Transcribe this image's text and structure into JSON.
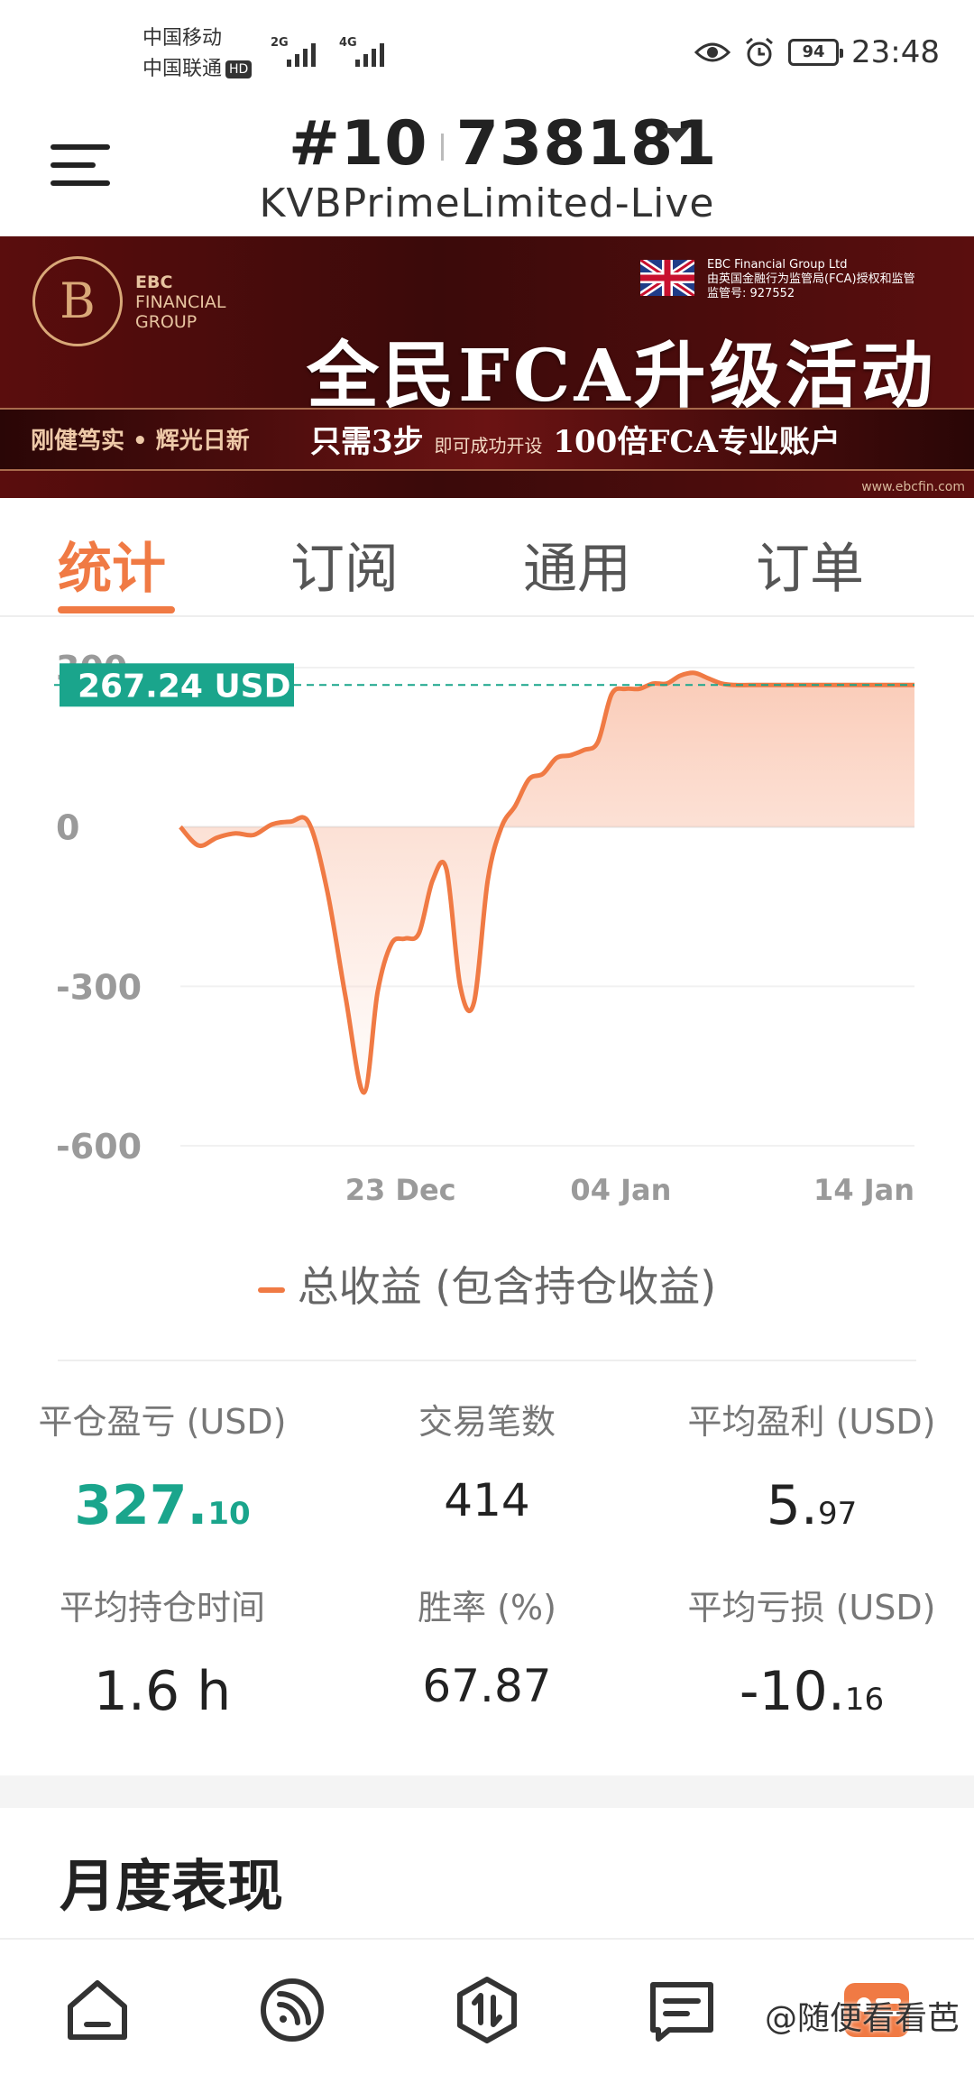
{
  "status_bar": {
    "carrier1": "中国移动",
    "carrier2": "中国联通",
    "hd": "HD",
    "net1": "2G",
    "net2": "4G",
    "battery": "94",
    "time": "23:48"
  },
  "header": {
    "rank": "#10",
    "account": "738181",
    "server": "KVBPrimeLimited-Live"
  },
  "banner": {
    "brand": [
      "EBC",
      "FINANCIAL",
      "GROUP"
    ],
    "regulator": [
      "EBC Financial Group Ltd",
      "由英国金融行为监管局(FCA)授权和监管",
      "监管号: 927552"
    ],
    "title": "全民FCA升级活动",
    "slogan": "刚健笃实 • 辉光日新",
    "strip_big1": "只需3步",
    "strip_small": "即可成功开设",
    "strip_big2": "100倍FCA专业账户",
    "url": "www.ebcfin.com"
  },
  "tabs": [
    {
      "label": "统计",
      "active": true
    },
    {
      "label": "订阅",
      "active": false
    },
    {
      "label": "通用",
      "active": false
    },
    {
      "label": "订单",
      "active": false
    }
  ],
  "chart_data": {
    "type": "area",
    "ylim": [
      -600,
      300
    ],
    "yticks": [
      300,
      0,
      -300,
      -600
    ],
    "ytick_labels": [
      "300",
      "0",
      "-300",
      "-600"
    ],
    "xtick_labels": [
      "23 Dec",
      "04 Jan",
      "14 Jan"
    ],
    "current_value_label": "267.24 USD",
    "current_value": 267.24,
    "legend": "总收益 (包含持仓收益)",
    "color": "#f07a44",
    "x_index": [
      0,
      4,
      8,
      12,
      16,
      20,
      24,
      28,
      32,
      36,
      40,
      43,
      46,
      49,
      52,
      55,
      58,
      61,
      64,
      67,
      70,
      73,
      76,
      79,
      82,
      85,
      88,
      91,
      94,
      97,
      100,
      103,
      106,
      109,
      112,
      115,
      118,
      121,
      124,
      127,
      130,
      133,
      136,
      139,
      142,
      145,
      148,
      151,
      154,
      157,
      160
    ],
    "values": [
      0,
      -35,
      -20,
      -12,
      -15,
      5,
      10,
      8,
      -120,
      -320,
      -500,
      -310,
      -220,
      -210,
      -200,
      -100,
      -80,
      -300,
      -330,
      -100,
      0,
      40,
      90,
      100,
      130,
      135,
      145,
      160,
      250,
      260,
      260,
      270,
      270,
      285,
      290,
      280,
      270,
      267.24,
      267.24,
      267.24,
      267.24,
      267.24,
      267.24,
      267.24,
      267.24,
      267.24,
      267.24,
      267.24,
      267.24,
      267.24,
      267.24
    ]
  },
  "stats": {
    "closed_pl_label": "平仓盈亏 (USD)",
    "closed_pl_int": "327.",
    "closed_pl_dec": "10",
    "trades_label": "交易笔数",
    "trades": "414",
    "avg_profit_label": "平均盈利 (USD)",
    "avg_profit_int": "5.",
    "avg_profit_dec": "97",
    "avg_hold_label": "平均持仓时间",
    "avg_hold": "1.6 h",
    "win_rate_label": "胜率 (%)",
    "win_rate": "67.87",
    "avg_loss_label": "平均亏损 (USD)",
    "avg_loss_int": "-10.",
    "avg_loss_dec": "16"
  },
  "section_title": "月度表现",
  "watermark": "@随便看看芭"
}
